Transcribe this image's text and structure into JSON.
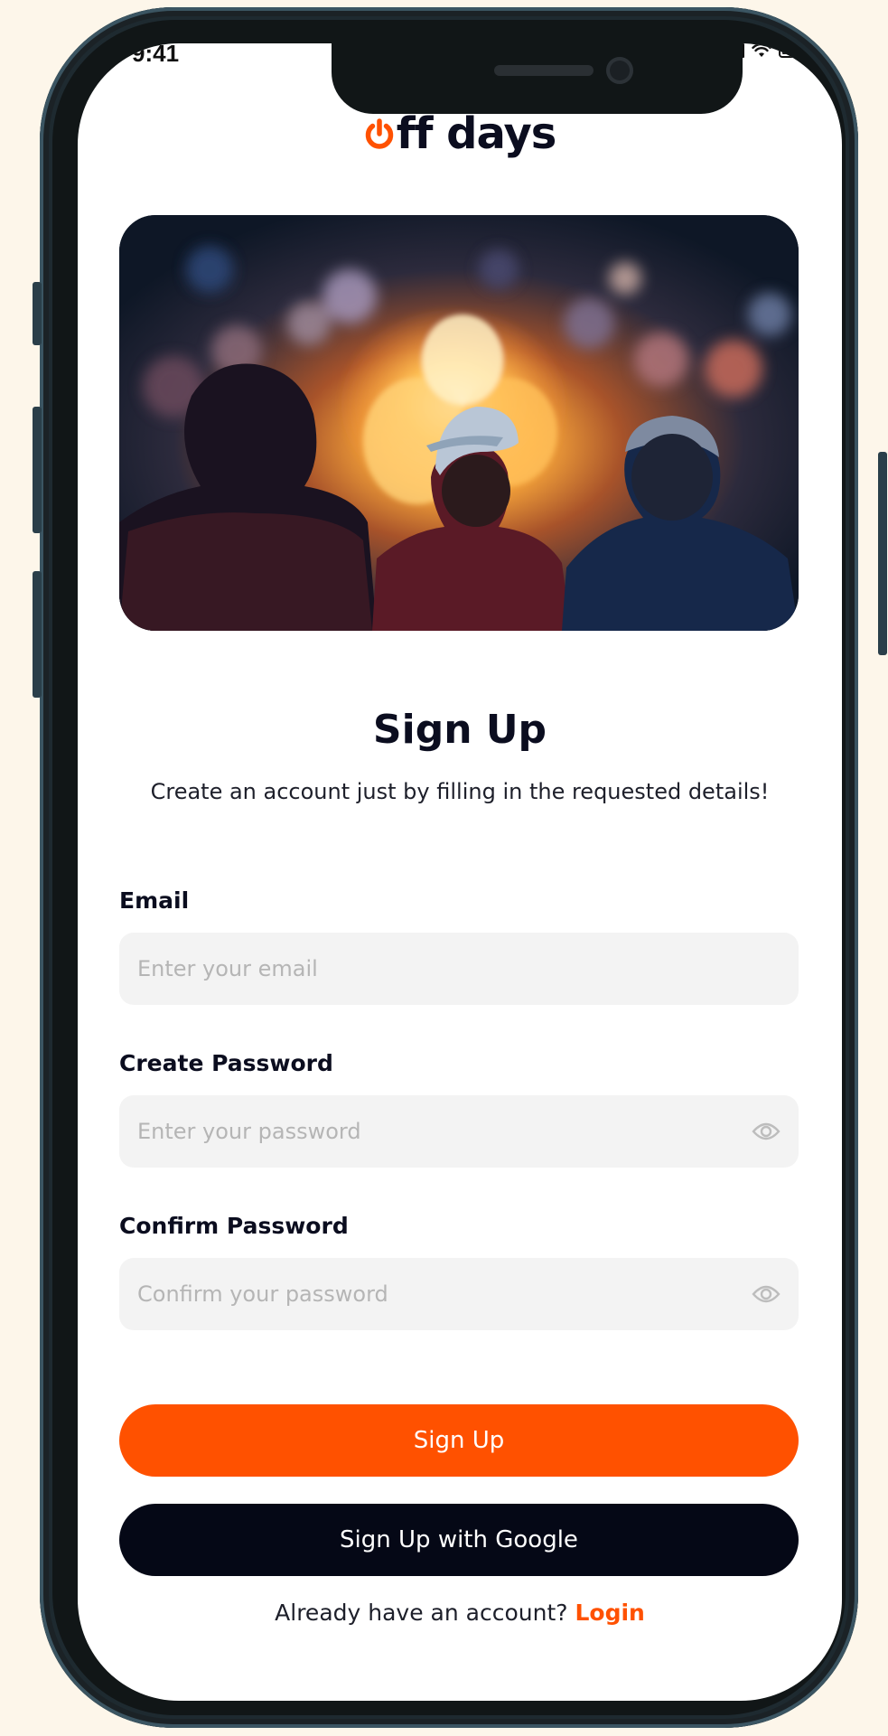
{
  "status_bar": {
    "time": "9:41"
  },
  "logo": {
    "text": "ff days"
  },
  "heading": {
    "title": "Sign Up",
    "subtitle": "Create an account just by filling in the requested details!"
  },
  "form": {
    "email": {
      "label": "Email",
      "placeholder": "Enter your email",
      "value": ""
    },
    "password": {
      "label": "Create Password",
      "placeholder": "Enter your password",
      "value": ""
    },
    "confirm_password": {
      "label": "Confirm Password",
      "placeholder": "Confirm your password",
      "value": ""
    }
  },
  "actions": {
    "signup_label": "Sign Up",
    "google_label": "Sign Up with Google"
  },
  "footer": {
    "prompt": "Already have an account?",
    "login_label": "Login"
  },
  "icons": {
    "logo_mark": "power-icon",
    "password_toggle": "eye-icon",
    "status": [
      "signal-icon",
      "wifi-icon",
      "battery-icon"
    ]
  },
  "colors": {
    "accent": "#ff5100",
    "dark_button": "#050816",
    "text": "#0b0d1f",
    "input_bg": "#f3f3f3",
    "page_bg": "#fdf6ea"
  }
}
